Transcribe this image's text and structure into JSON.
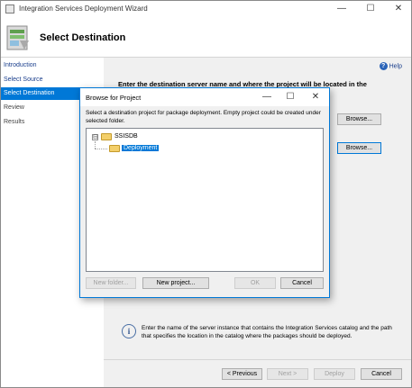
{
  "window": {
    "title": "Integration Services Deployment Wizard"
  },
  "header": {
    "title": "Select Destination"
  },
  "sidebar": {
    "items": [
      {
        "label": "Introduction"
      },
      {
        "label": "Select Source"
      },
      {
        "label": "Select Destination"
      },
      {
        "label": "Review"
      },
      {
        "label": "Results"
      }
    ]
  },
  "main": {
    "help_label": "Help",
    "instruction": "Enter the destination server name and where the project will be located in the",
    "browse_label": "Browse...",
    "info_text": "Enter the name of the server instance that contains the Integration Services catalog and the path that specifies the location in the catalog where the packages should be deployed."
  },
  "footer": {
    "previous_label": "< Previous",
    "next_label": "Next >",
    "deploy_label": "Deploy",
    "cancel_label": "Cancel"
  },
  "dialog": {
    "title": "Browse for Project",
    "description": "Select a destination project for package deployment. Empty project could be created under selected folder.",
    "tree": {
      "root": {
        "label": "SSISDB",
        "expander": "⊟"
      },
      "child": {
        "label": "Deployment"
      }
    },
    "buttons": {
      "new_folder": "New folder...",
      "new_project": "New project...",
      "ok": "OK",
      "cancel": "Cancel"
    }
  },
  "icons": {
    "minimize": "—",
    "maximize": "☐",
    "close": "✕",
    "help": "?",
    "info": "i"
  },
  "colors": {
    "accent": "#0078d7",
    "link": "#1a3e8c",
    "panel": "#f0f0f0"
  }
}
